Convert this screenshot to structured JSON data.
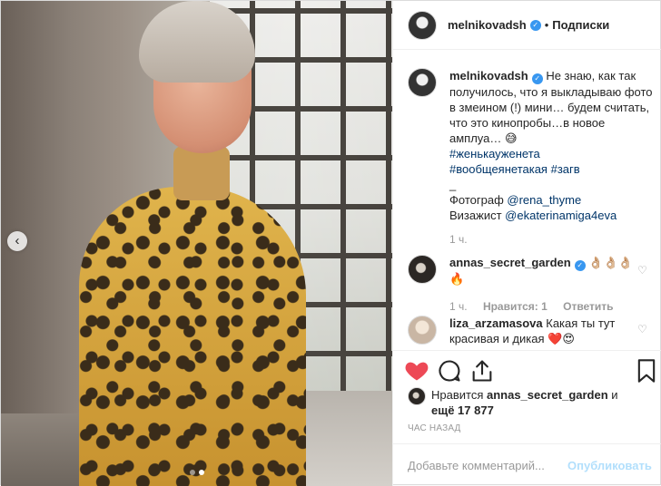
{
  "post": {
    "author": "melnikovadsh",
    "follow_label": "Подписки",
    "separator": "•"
  },
  "caption": {
    "author": "melnikovadsh",
    "text": "Не знаю, как так получилось, что я выкладываю фото в змеином (!) мини… будем считать, что это кинопробы…в новое амплуа… 😅",
    "hashtags": [
      "#женькауженета",
      "#вообщеянетакая",
      "#загв"
    ],
    "dash": "_",
    "photo_label": "Фотограф ",
    "photo_user": "@rena_thyme",
    "makeup_label": "Визажист ",
    "makeup_user": "@ekaterinamiga4eva",
    "time": "1 ч."
  },
  "comments": [
    {
      "user": "annas_secret_garden",
      "text": "👌🏼👌🏼👌🏼🔥",
      "time": "1 ч.",
      "likes": "Нравится: 1",
      "reply": "Ответить"
    },
    {
      "user": "liza_arzamasova",
      "text": "Какая ты тут красивая и дикая ❤️😍"
    }
  ],
  "likes": {
    "prefix": "Нравится ",
    "user": "annas_secret_garden",
    "connector": " и",
    "rest": "ещё 17 877"
  },
  "timestamp": "час назад",
  "comment_input": {
    "placeholder": "Добавьте комментарий...",
    "post_label": "Опубликовать"
  },
  "carousel": {
    "count": 2,
    "active": 1
  }
}
